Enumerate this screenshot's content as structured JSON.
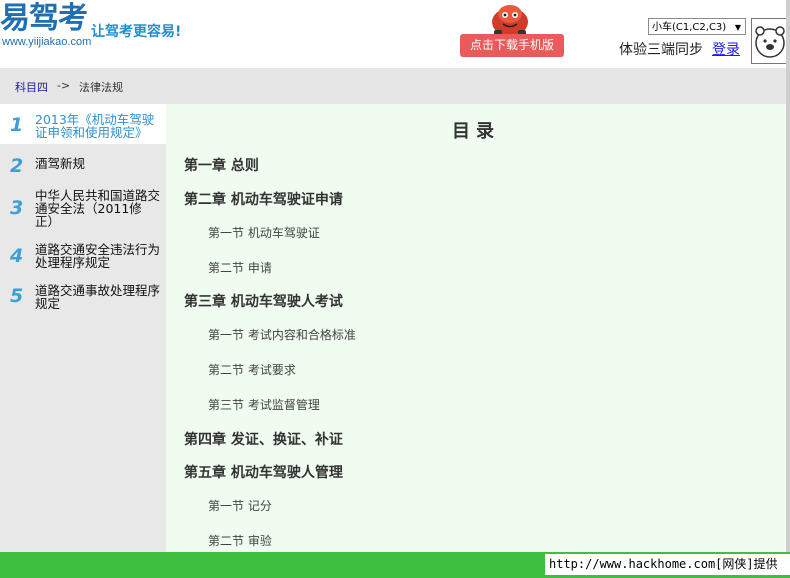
{
  "header": {
    "logo_text": "易驾考",
    "logo_url": "www.yiijiakao.com",
    "slogan": "让驾考更容易!",
    "download_button": "点击下载手机版",
    "car_type_select": "小车(C1,C2,C3)",
    "sync_text": "体验三端同步",
    "login_link": "登录"
  },
  "breadcrumb": {
    "subject": "科目四",
    "separator": "->",
    "current": "法律法规"
  },
  "sidebar": {
    "items": [
      {
        "number": "1",
        "label": "2013年《机动车驾驶证申领和使用规定》",
        "active": true
      },
      {
        "number": "2",
        "label": "酒驾新规",
        "active": false
      },
      {
        "number": "3",
        "label": "中华人民共和国道路交通安全法（2011修正）",
        "active": false
      },
      {
        "number": "4",
        "label": "道路交通安全违法行为处理程序规定",
        "active": false
      },
      {
        "number": "5",
        "label": "道路交通事故处理程序规定",
        "active": false
      }
    ]
  },
  "content": {
    "title": "目录",
    "entries": [
      {
        "type": "chapter",
        "text": "第一章  总则"
      },
      {
        "type": "chapter",
        "text": "第二章  机动车驾驶证申请"
      },
      {
        "type": "section",
        "text": "第一节  机动车驾驶证"
      },
      {
        "type": "section",
        "text": "第二节  申请"
      },
      {
        "type": "chapter",
        "text": "第三章  机动车驾驶人考试"
      },
      {
        "type": "section",
        "text": "第一节  考试内容和合格标准"
      },
      {
        "type": "section",
        "text": "第二节  考试要求"
      },
      {
        "type": "section",
        "text": "第三节  考试监督管理"
      },
      {
        "type": "chapter",
        "text": "第四章  发证、换证、补证"
      },
      {
        "type": "chapter",
        "text": "第五章  机动车驾驶人管理"
      },
      {
        "type": "section",
        "text": "第一节  记分"
      },
      {
        "type": "section",
        "text": "第二节  审验"
      }
    ]
  },
  "footer": {
    "watermark": "http://www.hackhome.com[网侠]提供"
  },
  "colors": {
    "brand_blue": "#1f6fb2",
    "download_red": "#e95a5a",
    "content_bg": "#effcef",
    "footer_green": "#3fbf3f"
  }
}
